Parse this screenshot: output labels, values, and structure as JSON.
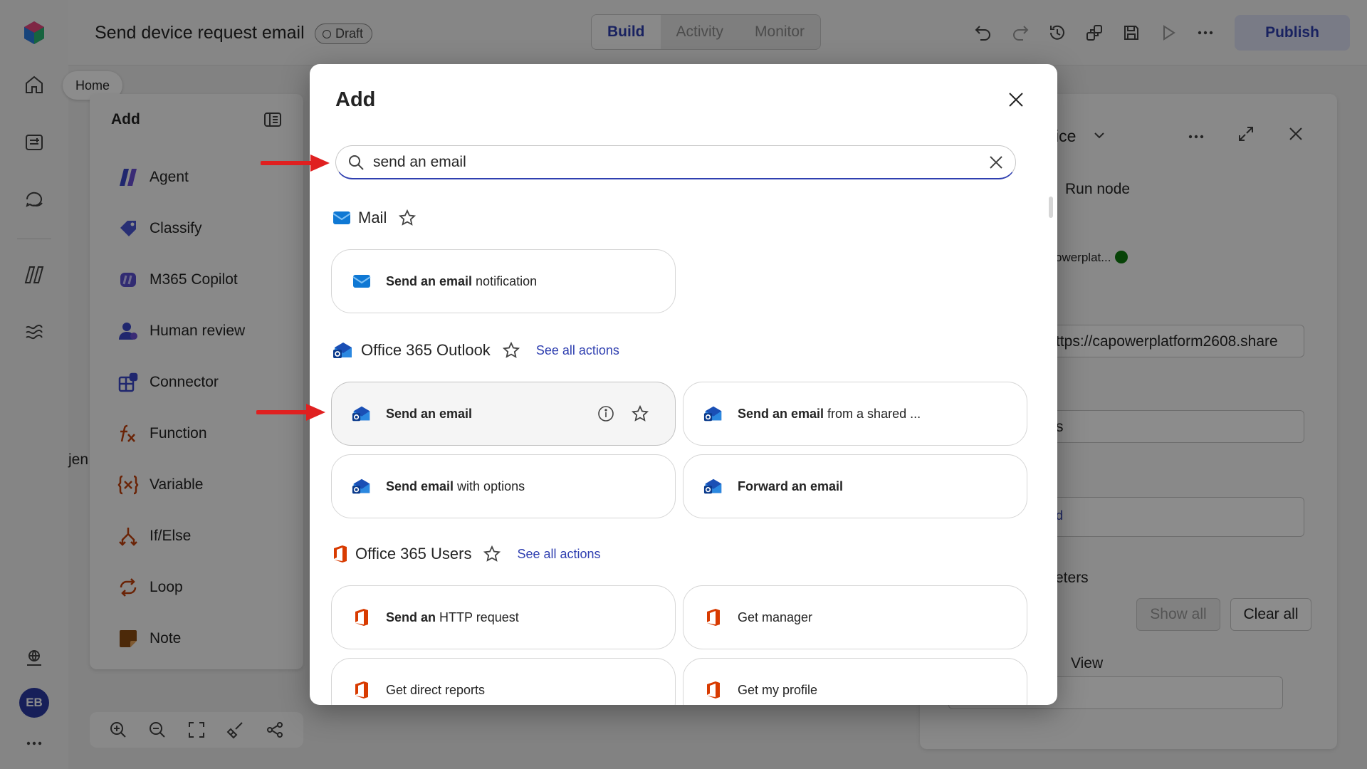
{
  "app": {
    "flow_title": "Send device request email",
    "status_badge": "Draft",
    "modes": [
      "Build",
      "Activity",
      "Monitor"
    ],
    "active_mode": "Build",
    "publish_label": "Publish",
    "user_initials": "EB"
  },
  "tooltip": {
    "home": "Home"
  },
  "add_panel": {
    "title": "Add",
    "items": [
      {
        "label": "Agent",
        "icon": "agent-icon"
      },
      {
        "label": "Classify",
        "icon": "classify-icon"
      },
      {
        "label": "M365 Copilot",
        "icon": "copilot-icon"
      },
      {
        "label": "Human review",
        "icon": "human-review-icon"
      },
      {
        "label": "Connector",
        "icon": "connector-icon"
      },
      {
        "label": "Function",
        "icon": "function-icon"
      },
      {
        "label": "Variable",
        "icon": "variable-icon"
      },
      {
        "label": "If/Else",
        "icon": "if-else-icon"
      },
      {
        "label": "Loop",
        "icon": "loop-icon"
      },
      {
        "label": "Note",
        "icon": "note-icon"
      }
    ],
    "canvas_fragment": "jen"
  },
  "properties_panel": {
    "title_fragment": "ice",
    "run_node": "Run node",
    "connection_fragment": "owerplat...",
    "site_fragment": "ttps://capowerplatform2608.share",
    "list_fragment": "s",
    "token_fragment": "d",
    "params_fragment": "eters",
    "show_all": "Show all",
    "clear_all": "Clear all",
    "view_fragment": "View"
  },
  "modal": {
    "title": "Add",
    "search": {
      "value": "send an email",
      "placeholder": ""
    },
    "groups": [
      {
        "name": "Mail",
        "see_all": "",
        "actions": [
          {
            "bold": "Send an email",
            "rest": " notification"
          }
        ]
      },
      {
        "name": "Office 365 Outlook",
        "see_all": "See all actions",
        "actions": [
          {
            "bold": "Send an email",
            "rest": ""
          },
          {
            "bold": "Send an email",
            "rest": " from a shared ..."
          },
          {
            "bold": "Send email",
            "rest": " with options"
          },
          {
            "bold": "Forward an email",
            "rest": ""
          }
        ]
      },
      {
        "name": "Office 365 Users",
        "see_all": "See all actions",
        "actions": [
          {
            "bold": "Send an",
            "rest": " HTTP request"
          },
          {
            "bold": "",
            "rest": "Get manager"
          },
          {
            "bold": "",
            "rest": "Get direct reports"
          },
          {
            "bold": "",
            "rest": "Get my profile"
          }
        ]
      }
    ]
  },
  "colors": {
    "accent": "#2f3fb0",
    "annotation_arrow": "#e02020",
    "office_red": "#d83b01",
    "mail_blue": "#0f78d4"
  }
}
